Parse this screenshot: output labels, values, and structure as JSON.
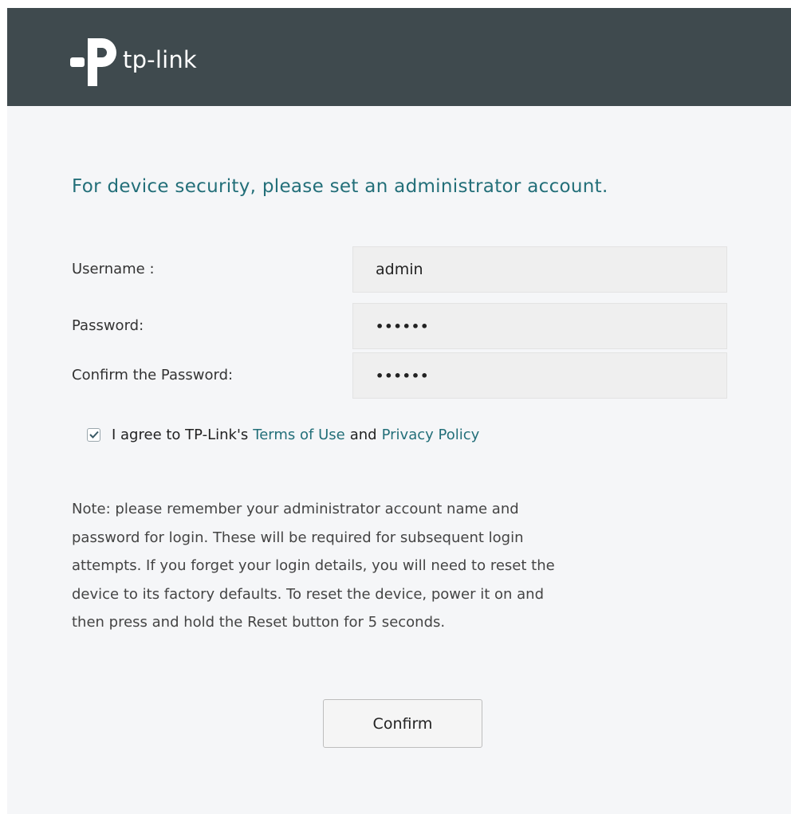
{
  "header": {
    "logo_text": "tp-link",
    "background_color": "#3f4a4e",
    "logo_icon": "tp-link-logo-icon"
  },
  "form": {
    "heading": "For device security, please set an administrator account.",
    "username": {
      "label": "Username :",
      "value": "admin"
    },
    "password": {
      "label": "Password:",
      "value": "••••••"
    },
    "confirm_password": {
      "label": "Confirm the Password:",
      "value": "••••••"
    }
  },
  "agreement": {
    "checked": true,
    "checkbox_icon": "checkmark-icon",
    "text_prefix": "I agree to TP-Link's",
    "terms_link": "Terms of Use",
    "conjunction": "and",
    "privacy_link": "Privacy Policy"
  },
  "note": {
    "lines": [
      "Note: please remember your administrator account name and",
      "password for login. These will be required for subsequent login",
      "attempts. If you forget your login details, you will need to reset the",
      "device to its factory defaults. To reset the device, power it on and",
      "then press and hold the Reset button for 5 seconds."
    ]
  },
  "actions": {
    "confirm_label": "Confirm"
  },
  "colors": {
    "accent": "#236f79",
    "page_background": "#f5f6f8"
  }
}
